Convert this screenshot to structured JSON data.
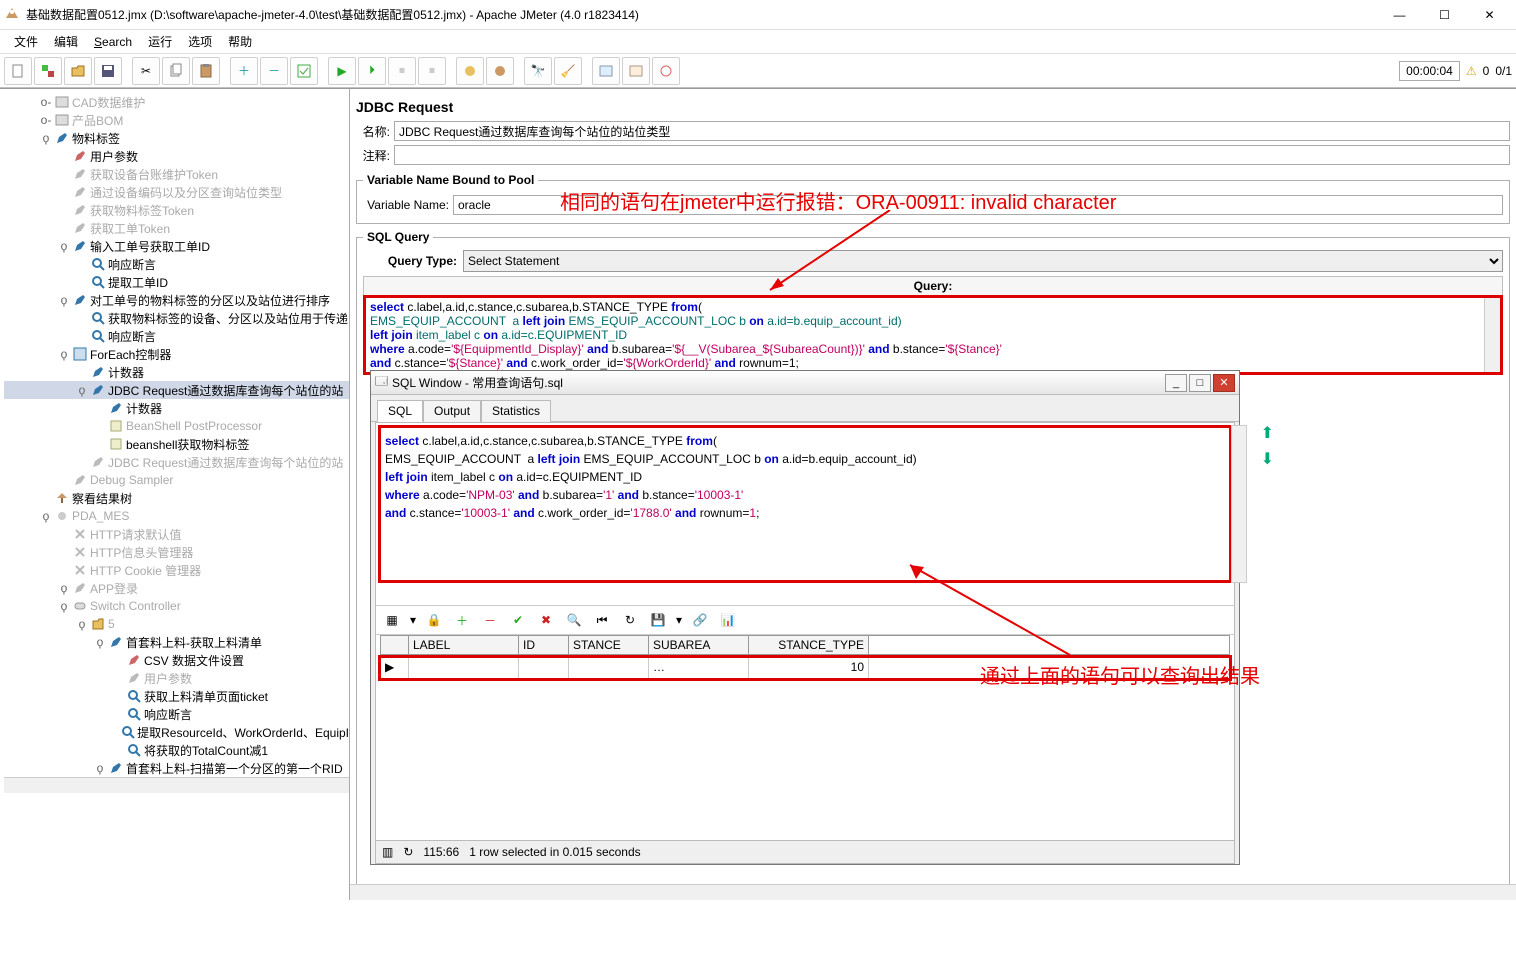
{
  "window": {
    "title": "基础数据配置0512.jmx (D:\\software\\apache-jmeter-4.0\\test\\基础数据配置0512.jmx) - Apache JMeter (4.0 r1823414)"
  },
  "menus": {
    "file": "文件",
    "edit": "编辑",
    "search": "Search",
    "run": "运行",
    "options": "选项",
    "help": "帮助"
  },
  "status": {
    "time": "00:00:04",
    "warnings": "0",
    "threads": "0/1"
  },
  "tree": [
    {
      "l": 0,
      "h": "o-",
      "icon": "cad",
      "label": "CAD数据维护",
      "dim": true
    },
    {
      "l": 0,
      "h": "o-",
      "icon": "cad",
      "label": "产品BOM",
      "dim": true
    },
    {
      "l": 0,
      "h": "ϙ",
      "icon": "pencilB",
      "label": "物料标签"
    },
    {
      "l": 1,
      "h": "",
      "icon": "pencil",
      "label": "用户参数"
    },
    {
      "l": 1,
      "h": "",
      "icon": "pencilG",
      "label": "获取设备台账维护Token",
      "dim": true
    },
    {
      "l": 1,
      "h": "",
      "icon": "pencilG",
      "label": "通过设备编码以及分区查询站位类型",
      "dim": true
    },
    {
      "l": 1,
      "h": "",
      "icon": "pencilG",
      "label": "获取物料标签Token",
      "dim": true
    },
    {
      "l": 1,
      "h": "",
      "icon": "pencilG",
      "label": "获取工单Token",
      "dim": true
    },
    {
      "l": 1,
      "h": "ϙ",
      "icon": "pencilB",
      "label": "输入工单号获取工单ID"
    },
    {
      "l": 2,
      "h": "",
      "icon": "mag",
      "label": "响应断言"
    },
    {
      "l": 2,
      "h": "",
      "icon": "mag",
      "label": "提取工单ID"
    },
    {
      "l": 1,
      "h": "ϙ",
      "icon": "pencilB",
      "label": "对工单号的物料标签的分区以及站位进行排序"
    },
    {
      "l": 2,
      "h": "",
      "icon": "mag",
      "label": "获取物料标签的设备、分区以及站位用于传递"
    },
    {
      "l": 2,
      "h": "",
      "icon": "mag",
      "label": "响应断言"
    },
    {
      "l": 1,
      "h": "ϙ",
      "icon": "foreach",
      "label": "ForEach控制器"
    },
    {
      "l": 2,
      "h": "",
      "icon": "pencilB",
      "label": "计数器"
    },
    {
      "l": 2,
      "h": "ϙ",
      "icon": "pencilB",
      "label": "JDBC Request通过数据库查询每个站位的站",
      "sel": true
    },
    {
      "l": 3,
      "h": "",
      "icon": "pencilB",
      "label": "计数器"
    },
    {
      "l": 3,
      "h": "",
      "icon": "bean",
      "label": "BeanShell PostProcessor",
      "dim": true
    },
    {
      "l": 3,
      "h": "",
      "icon": "bean",
      "label": "beanshell获取物料标签"
    },
    {
      "l": 2,
      "h": "",
      "icon": "pencilG",
      "label": "JDBC Request通过数据库查询每个站位的站",
      "dim": true
    },
    {
      "l": 1,
      "h": "",
      "icon": "pencilG",
      "label": "Debug Sampler",
      "dim": true
    },
    {
      "l": 0,
      "h": "",
      "icon": "tree",
      "label": "察看结果树"
    },
    {
      "l": 0,
      "h": "ϙ",
      "icon": "gear",
      "label": "PDA_MES",
      "dim": true
    },
    {
      "l": 1,
      "h": "",
      "icon": "x",
      "label": "HTTP请求默认值",
      "dim": true
    },
    {
      "l": 1,
      "h": "",
      "icon": "x",
      "label": "HTTP信息头管理器",
      "dim": true
    },
    {
      "l": 1,
      "h": "",
      "icon": "x",
      "label": "HTTP Cookie 管理器",
      "dim": true
    },
    {
      "l": 1,
      "h": "ϙ",
      "icon": "pencilG",
      "label": "APP登录",
      "dim": true
    },
    {
      "l": 1,
      "h": "ϙ",
      "icon": "switch",
      "label": "Switch Controller",
      "dim": true
    },
    {
      "l": 2,
      "h": "ϙ",
      "icon": "fold",
      "label": "5",
      "dim": true
    },
    {
      "l": 3,
      "h": "ϙ",
      "icon": "pencilB",
      "label": "首套料上料-获取上料清单"
    },
    {
      "l": 4,
      "h": "",
      "icon": "pencil",
      "label": "CSV 数据文件设置"
    },
    {
      "l": 4,
      "h": "",
      "icon": "pencilG",
      "label": "用户参数",
      "dim": true
    },
    {
      "l": 4,
      "h": "",
      "icon": "mag",
      "label": "获取上料清单页面ticket"
    },
    {
      "l": 4,
      "h": "",
      "icon": "mag",
      "label": "响应断言"
    },
    {
      "l": 4,
      "h": "",
      "icon": "mag",
      "label": "提取ResourceId、WorkOrderId、EquipI"
    },
    {
      "l": 4,
      "h": "",
      "icon": "mag",
      "label": "将获取的TotalCount减1"
    },
    {
      "l": 3,
      "h": "ϙ",
      "icon": "pencilB",
      "label": "首套料上料-扫描第一个分区的第一个RID"
    }
  ],
  "right": {
    "panel_title": "JDBC Request",
    "name_lbl": "名称:",
    "name_val": "JDBC Request通过数据库查询每个站位的站位类型",
    "comment_lbl": "注释:",
    "comment_val": "",
    "vnbp": "Variable Name Bound to Pool",
    "vn_lbl": "Variable Name:",
    "vn_val": "oracle",
    "sqlq": "SQL Query",
    "qt_lbl": "Query Type:",
    "qt_val": "Select Statement",
    "query_lbl": "Query:"
  },
  "annotations": {
    "top": "相同的语句在jmeter中运行报错：ORA-00911: invalid character",
    "bottom": "通过上面的语句可以查询出结果"
  },
  "chart_data": {
    "type": "table",
    "jmeter_sql": {
      "lines": [
        [
          {
            "t": "select ",
            "c": "blue"
          },
          {
            "t": "c.label,a.id,c.stance,c.subarea,b.STANCE_TYPE ",
            "c": ""
          },
          {
            "t": "from",
            "c": "blue"
          },
          {
            "t": "(",
            "c": ""
          }
        ],
        [
          {
            "t": "EMS_EQUIP_ACCOUNT  a ",
            "c": "teal"
          },
          {
            "t": "left join ",
            "c": "blue"
          },
          {
            "t": "EMS_EQUIP_ACCOUNT_LOC b ",
            "c": "teal"
          },
          {
            "t": "on ",
            "c": "blue"
          },
          {
            "t": "a.id=b.equip_account_id)",
            "c": "teal"
          }
        ],
        [
          {
            "t": "left join ",
            "c": "blue"
          },
          {
            "t": "item_label c ",
            "c": "teal"
          },
          {
            "t": "on ",
            "c": "blue"
          },
          {
            "t": "a.id=c.EQUIPMENT_ID",
            "c": "teal"
          }
        ],
        [
          {
            "t": "where ",
            "c": "blue"
          },
          {
            "t": "a.code=",
            "c": ""
          },
          {
            "t": "'${EquipmentId_Display}'",
            "c": "red"
          },
          {
            "t": " and ",
            "c": "blue"
          },
          {
            "t": "b.subarea=",
            "c": ""
          },
          {
            "t": "'${__V(Subarea_${SubareaCount})}'",
            "c": "red"
          },
          {
            "t": " and ",
            "c": "blue"
          },
          {
            "t": "b.stance=",
            "c": ""
          },
          {
            "t": "'${Stance}'",
            "c": "red"
          }
        ],
        [
          {
            "t": "and ",
            "c": "blue"
          },
          {
            "t": "c.stance=",
            "c": ""
          },
          {
            "t": "'${Stance}'",
            "c": "red"
          },
          {
            "t": " and ",
            "c": "blue"
          },
          {
            "t": "c.work_order_id=",
            "c": ""
          },
          {
            "t": "'${WorkOrderId}'",
            "c": "red"
          },
          {
            "t": " and ",
            "c": "blue"
          },
          {
            "t": "rownum=1;",
            "c": ""
          }
        ]
      ]
    },
    "plsql_sql": {
      "lines": [
        [
          {
            "t": "select ",
            "c": "blue"
          },
          {
            "t": "c.label,a.id,c.stance,c.subarea,b.STANCE_TYPE ",
            "c": ""
          },
          {
            "t": "from",
            "c": "blue"
          },
          {
            "t": "(",
            "c": ""
          }
        ],
        [
          {
            "t": "EMS_EQUIP_ACCOUNT  a ",
            "c": ""
          },
          {
            "t": "left join ",
            "c": "blue"
          },
          {
            "t": "EMS_EQUIP_ACCOUNT_LOC b ",
            "c": ""
          },
          {
            "t": "on ",
            "c": "blue"
          },
          {
            "t": "a.id=b.equip_account_id)",
            "c": ""
          }
        ],
        [
          {
            "t": "left join ",
            "c": "blue"
          },
          {
            "t": "item_label c ",
            "c": ""
          },
          {
            "t": "on ",
            "c": "blue"
          },
          {
            "t": "a.id=c.EQUIPMENT_ID",
            "c": ""
          }
        ],
        [
          {
            "t": "where ",
            "c": "blue"
          },
          {
            "t": "a.code=",
            "c": ""
          },
          {
            "t": "'NPM-03'",
            "c": "red"
          },
          {
            "t": " and ",
            "c": "blue"
          },
          {
            "t": "b.subarea=",
            "c": ""
          },
          {
            "t": "'1'",
            "c": "red"
          },
          {
            "t": " and ",
            "c": "blue"
          },
          {
            "t": "b.stance=",
            "c": ""
          },
          {
            "t": "'10003-1'",
            "c": "red"
          }
        ],
        [
          {
            "t": "and ",
            "c": "blue"
          },
          {
            "t": "c.stance=",
            "c": ""
          },
          {
            "t": "'10003-1'",
            "c": "red"
          },
          {
            "t": " and ",
            "c": "blue"
          },
          {
            "t": "c.work_order_id=",
            "c": ""
          },
          {
            "t": "'1788.0'",
            "c": "red"
          },
          {
            "t": " and ",
            "c": "blue"
          },
          {
            "t": "rownum=",
            "c": ""
          },
          {
            "t": "1",
            "c": "red"
          },
          {
            "t": ";",
            "c": ""
          }
        ]
      ]
    },
    "grid": {
      "headers": [
        "",
        "LABEL",
        "ID",
        "STANCE",
        "SUBAREA",
        "STANCE_TYPE"
      ],
      "row": [
        "▶",
        "",
        "",
        "",
        "…",
        "10"
      ]
    }
  },
  "sqlwin": {
    "title": "SQL Window - 常用查询语句.sql",
    "tabs": [
      "SQL",
      "Output",
      "Statistics"
    ],
    "status_pos": "115:66",
    "status_msg": "1 row selected in 0.015 seconds"
  }
}
